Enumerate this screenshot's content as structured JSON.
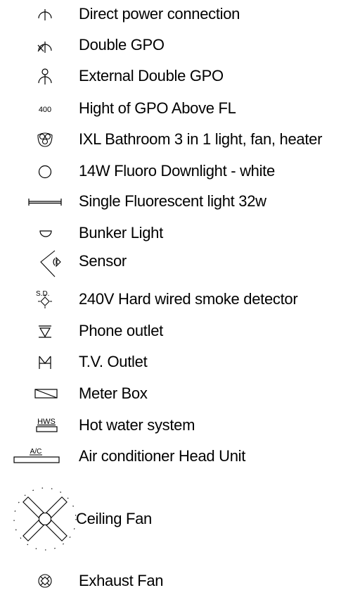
{
  "legend": {
    "items": [
      {
        "label": "Direct power connection",
        "icon": "direct-power-connection-icon"
      },
      {
        "label": "Double GPO",
        "icon": "double-gpo-icon"
      },
      {
        "label": "External Double GPO",
        "icon": "external-double-gpo-icon"
      },
      {
        "label": "Hight of GPO Above FL",
        "icon": "gpo-height-icon",
        "icon_text": "400"
      },
      {
        "label": "IXL Bathroom 3 in 1 light, fan, heater",
        "icon": "ixl-bathroom-3in1-icon"
      },
      {
        "label": "14W Fluoro Downlight - white",
        "icon": "downlight-icon"
      },
      {
        "label": "Single Fluorescent light 32w",
        "icon": "fluorescent-light-icon"
      },
      {
        "label": "Bunker Light",
        "icon": "bunker-light-icon"
      },
      {
        "label": "Sensor",
        "icon": "sensor-icon"
      },
      {
        "label": "240V Hard wired smoke detector",
        "icon": "smoke-detector-icon",
        "icon_text": "S.D."
      },
      {
        "label": "Phone outlet",
        "icon": "phone-outlet-icon"
      },
      {
        "label": "T.V. Outlet",
        "icon": "tv-outlet-icon"
      },
      {
        "label": "Meter Box",
        "icon": "meter-box-icon"
      },
      {
        "label": "Hot water system",
        "icon": "hot-water-system-icon",
        "icon_text": "HWS"
      },
      {
        "label": "Air conditioner Head Unit",
        "icon": "air-conditioner-icon",
        "icon_text": "A/C"
      },
      {
        "label": "Ceiling Fan",
        "icon": "ceiling-fan-icon"
      },
      {
        "label": "Exhaust Fan",
        "icon": "exhaust-fan-icon"
      }
    ]
  }
}
